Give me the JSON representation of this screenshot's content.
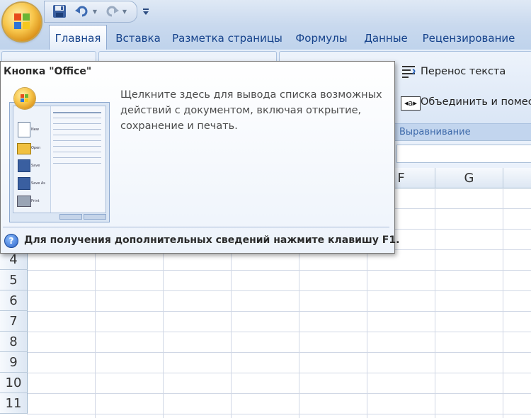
{
  "qat": {
    "save_icon": "save-icon",
    "undo_icon": "undo-icon",
    "redo_icon": "redo-icon",
    "customize_icon": "customize-qat-icon"
  },
  "tabs": [
    {
      "label": "Главная",
      "active": true
    },
    {
      "label": "Вставка",
      "active": false
    },
    {
      "label": "Разметка страницы",
      "active": false
    },
    {
      "label": "Формулы",
      "active": false
    },
    {
      "label": "Данные",
      "active": false
    },
    {
      "label": "Рецензирование",
      "active": false
    }
  ],
  "ribbon": {
    "wrap_text": "Перенос текста",
    "merge": "Объединить и помест",
    "alignment_group": "Выравнивание"
  },
  "columns": [
    "F",
    "G"
  ],
  "rows": [
    "4",
    "5",
    "6",
    "7",
    "8",
    "9",
    "10",
    "11"
  ],
  "tooltip": {
    "title": "Кнопка \"Office\"",
    "description": "Щелкните здесь для вывода списка возможных действий с документом, включая открытие, сохранение и печать.",
    "help": "Для получения дополнительных сведений нажмите клавишу F1.",
    "preview_menu": [
      "New",
      "Open",
      "Save",
      "Save As",
      "Print"
    ]
  },
  "colors": {
    "tab_text": "#15428b",
    "ribbon_bg": "#d4e1f3",
    "group_title": "#3e6aaa"
  }
}
